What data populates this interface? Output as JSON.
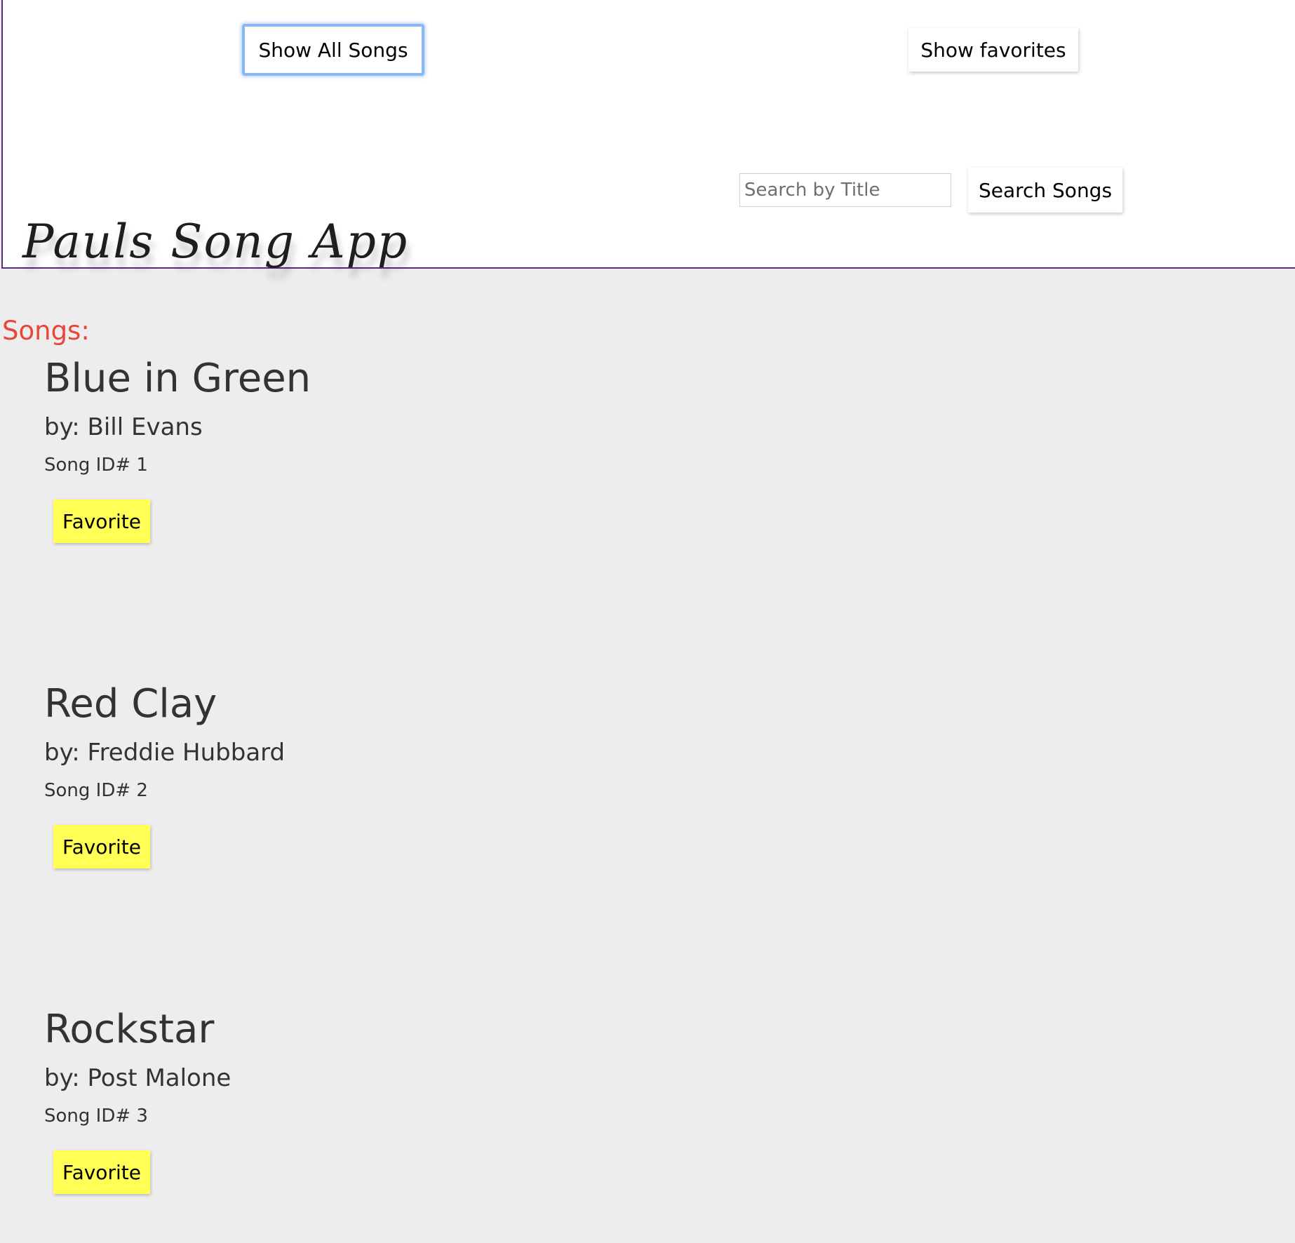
{
  "header": {
    "show_all_label": "Show All Songs",
    "show_favorites_label": "Show favorites",
    "search_placeholder": "Search by Title",
    "search_value": "",
    "search_button_label": "Search Songs",
    "app_title": "Pauls Song App"
  },
  "main": {
    "heading": "Songs:",
    "songs": [
      {
        "title": "Blue in Green",
        "artist": "by: Bill Evans",
        "song_id": "Song ID# 1",
        "favorite_label": "Favorite"
      },
      {
        "title": "Red Clay",
        "artist": "by: Freddie Hubbard",
        "song_id": "Song ID# 2",
        "favorite_label": "Favorite"
      },
      {
        "title": "Rockstar",
        "artist": "by: Post Malone",
        "song_id": "Song ID# 3",
        "favorite_label": "Favorite"
      }
    ]
  },
  "colors": {
    "page_background": "#ededed",
    "header_background": "#ffffff",
    "header_border": "#5b2a86",
    "songs_heading": "#e8463a",
    "favorite_button": "#ffff55",
    "focus_ring": "#8ab8f5"
  }
}
